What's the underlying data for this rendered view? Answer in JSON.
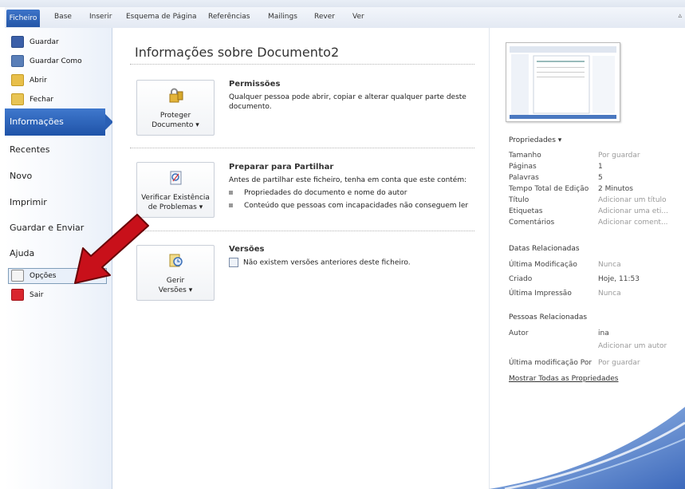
{
  "ribbon": {
    "file_tab": "Ficheiro",
    "tabs": [
      "Base",
      "Inserir",
      "Esquema de Página",
      "Referências",
      "Mailings",
      "Rever",
      "Ver"
    ]
  },
  "sidebar": {
    "small_top": [
      {
        "label": "Guardar",
        "icon": "save-icon"
      },
      {
        "label": "Guardar Como",
        "icon": "save-as-icon"
      },
      {
        "label": "Abrir",
        "icon": "open-folder-icon"
      },
      {
        "label": "Fechar",
        "icon": "close-folder-icon"
      }
    ],
    "selected": "Informações",
    "big_items": [
      "Recentes",
      "Novo",
      "Imprimir",
      "Guardar e Enviar",
      "Ajuda"
    ],
    "small_bottom": [
      {
        "label": "Opções",
        "icon": "options-icon"
      },
      {
        "label": "Sair",
        "icon": "exit-icon"
      }
    ]
  },
  "main": {
    "title": "Informações sobre Documento2",
    "sections": [
      {
        "button_lines": [
          "Proteger",
          "Documento ▾"
        ],
        "title": "Permissões",
        "text": "Qualquer pessoa pode abrir, copiar e alterar qualquer parte deste documento.",
        "bullets": []
      },
      {
        "button_lines": [
          "Verificar Existência",
          "de Problemas ▾"
        ],
        "title": "Preparar para Partilhar",
        "text": "Antes de partilhar este ficheiro, tenha em conta que este contém:",
        "bullets": [
          "Propriedades do documento e nome do autor",
          "Conteúdo que pessoas com incapacidades não conseguem ler"
        ]
      },
      {
        "button_lines": [
          "Gerir",
          "Versões ▾"
        ],
        "title": "Versões",
        "text": "Não existem versões anteriores deste ficheiro.",
        "bullets": []
      }
    ]
  },
  "properties": {
    "header": "Propriedades ▾",
    "rows": [
      {
        "label": "Tamanho",
        "value": "Por guardar",
        "grey": true
      },
      {
        "label": "Páginas",
        "value": "1",
        "grey": false
      },
      {
        "label": "Palavras",
        "value": "5",
        "grey": false
      },
      {
        "label": "Tempo Total de Edição",
        "value": "2 Minutos",
        "grey": false
      },
      {
        "label": "Título",
        "value": "Adicionar um título",
        "grey": true
      },
      {
        "label": "Etiquetas",
        "value": "Adicionar uma eti...",
        "grey": true
      },
      {
        "label": "Comentários",
        "value": "Adicionar coment...",
        "grey": true
      }
    ],
    "dates_header": "Datas Relacionadas",
    "dates": [
      {
        "label": "Última Modificação",
        "value": "Nunca",
        "grey": true
      },
      {
        "label": "Criado",
        "value": "Hoje, 11:53",
        "grey": false
      },
      {
        "label": "Última Impressão",
        "value": "Nunca",
        "grey": true
      }
    ],
    "people_header": "Pessoas Relacionadas",
    "people": [
      {
        "label": "Autor",
        "value": "ina",
        "grey": false
      },
      {
        "label": "",
        "value": "Adicionar um autor",
        "grey": true
      },
      {
        "label": "Última modificação Por",
        "value": "Por guardar",
        "grey": true
      }
    ],
    "show_all": "Mostrar Todas as Propriedades"
  },
  "colors": {
    "accent": "#2a5fb4",
    "arrow": "#c8101a"
  }
}
